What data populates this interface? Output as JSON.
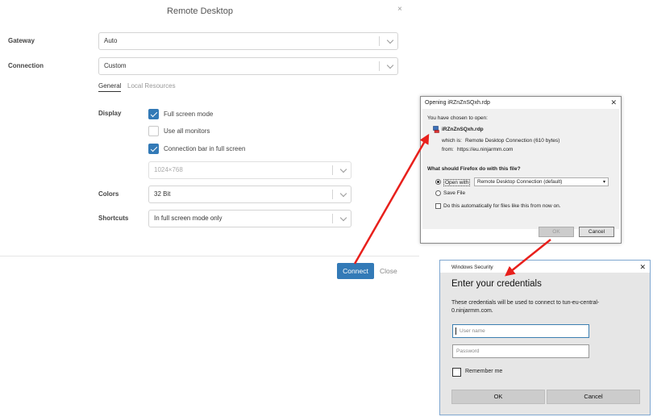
{
  "remote_desktop": {
    "title": "Remote Desktop",
    "close_glyph": "×",
    "gateway": {
      "label": "Gateway",
      "value": "Auto"
    },
    "connection": {
      "label": "Connection",
      "value": "Custom"
    },
    "tabs": [
      {
        "label": "General",
        "active": true
      },
      {
        "label": "Local Resources",
        "active": false
      }
    ],
    "display": {
      "label": "Display",
      "options": [
        {
          "label": "Full screen mode",
          "checked": true
        },
        {
          "label": "Use all monitors",
          "checked": false
        },
        {
          "label": "Connection bar in full screen",
          "checked": true
        }
      ],
      "resolution": "1024×768"
    },
    "colors": {
      "label": "Colors",
      "value": "32 Bit"
    },
    "shortcuts": {
      "label": "Shortcuts",
      "value": "In full screen mode only"
    },
    "buttons": {
      "connect": "Connect",
      "close": "Close"
    }
  },
  "firefox_dialog": {
    "title": "Opening iRZnZnSQxh.rdp",
    "close_glyph": "✕",
    "chosen_text": "You have chosen to open:",
    "filename": "iRZnZnSQxh.rdp",
    "which_is_label": "which is:",
    "which_is_value": "Remote Desktop Connection (610 bytes)",
    "from_label": "from:",
    "from_value": "https://eu.ninjarmm.com",
    "question": "What should Firefox do with this file?",
    "open_with_label": "Open with",
    "open_with_app": "Remote Desktop Connection (default)",
    "save_file_label": "Save File",
    "auto_label": "Do this automatically for files like this from now on.",
    "ok": "OK",
    "cancel": "Cancel"
  },
  "windows_security": {
    "title": "Windows Security",
    "close_glyph": "✕",
    "heading": "Enter your credentials",
    "message": "These credentials will be used to connect to tun-eu-central-0.ninjarmm.com.",
    "username_placeholder": "User name",
    "password_placeholder": "Password",
    "remember_label": "Remember me",
    "ok": "OK",
    "cancel": "Cancel"
  },
  "colors": {
    "accent_blue": "#337ab7",
    "annotation_red": "#e8201c"
  }
}
